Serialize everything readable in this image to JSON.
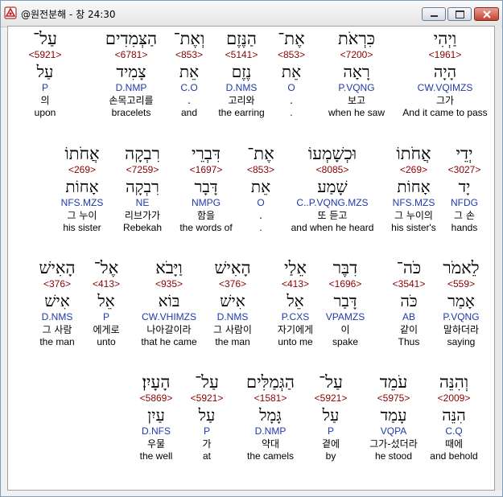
{
  "window": {
    "title": "@원전분해 - 창 24:30"
  },
  "rows": [
    [
      {
        "heb": "וַיְהִי",
        "strong": "<1961>",
        "lemma": "הָיָה",
        "morph": "CW.VQIMZS",
        "kor": "그가",
        "eng": "And it came to pass",
        "highlight": true
      },
      {
        "heb": "כִּרְאֹת",
        "strong": "<7200>",
        "lemma": "רָאָה",
        "morph": "P.VQNG",
        "kor": "보고",
        "eng": "when he saw"
      },
      {
        "heb": "אֶת־",
        "strong": "<853>",
        "lemma": "אֵת",
        "morph": "O",
        "kor": ".",
        "eng": "."
      },
      {
        "heb": "הַנֶּזֶם",
        "strong": "<5141>",
        "lemma": "נֶזֶם",
        "morph": "D.NMS",
        "kor": "고리와",
        "eng": "the earring"
      },
      {
        "heb": "וְאֶת־",
        "strong": "<853>",
        "lemma": "אֵת",
        "morph": "C.O",
        "kor": ".",
        "eng": "and"
      },
      {
        "heb": "הַצְּמִדִים",
        "strong": "<6781>",
        "lemma": "צָמִיד",
        "morph": "D.NMP",
        "kor": "손목고리를",
        "eng": "bracelets"
      },
      {
        "heb": "עַל־",
        "strong": "<5921>",
        "lemma": "עַל",
        "morph": "P",
        "kor": "의",
        "eng": "upon"
      }
    ],
    [
      {
        "heb": "יְדֵי",
        "strong": "<3027>",
        "lemma": "יָד",
        "morph": "NFDG",
        "kor": "그 손",
        "eng": "hands"
      },
      {
        "heb": "אֲחֹתוֹ",
        "strong": "<269>",
        "lemma": "אָחוֹת",
        "morph": "NFS.MZS",
        "kor": "그 누이의",
        "eng": "his sister's"
      },
      {
        "heb": "וּכְשָׁמְעוֹ",
        "strong": "<8085>",
        "lemma": "שָׁמַע",
        "morph": "C..P.VQNG.MZS",
        "kor": "또 듣고",
        "eng": "and when he heard"
      },
      {
        "heb": "אֶת־",
        "strong": "<853>",
        "lemma": "אֵת",
        "morph": "O",
        "kor": ".",
        "eng": "."
      },
      {
        "heb": "דִּבְרֵי",
        "strong": "<1697>",
        "lemma": "דָּבָר",
        "morph": "NMPG",
        "kor": "함을",
        "eng": "the words of"
      },
      {
        "heb": "רִבְקָה",
        "strong": "<7259>",
        "lemma": "רִבְקָה",
        "morph": "NE",
        "kor": "리브가가",
        "eng": "Rebekah"
      },
      {
        "heb": "אֲחֹתוֹ",
        "strong": "<269>",
        "lemma": "אָחוֹת",
        "morph": "NFS.MZS",
        "kor": "그 누이",
        "eng": "his sister"
      }
    ],
    [
      {
        "heb": "לֵאמֹר",
        "strong": "<559>",
        "lemma": "אָמַר",
        "morph": "P.VQNG",
        "kor": "말하더라",
        "eng": "saying"
      },
      {
        "heb": "כֹּה־",
        "strong": "<3541>",
        "lemma": "כֹּה",
        "morph": "AB",
        "kor": "같이",
        "eng": "Thus"
      },
      {
        "heb": "דִבֶּר",
        "strong": "<1696>",
        "lemma": "דָּבַר",
        "morph": "VPAMZS",
        "kor": "이",
        "eng": "spake"
      },
      {
        "heb": "אֵלַי",
        "strong": "<413>",
        "lemma": "אֵל",
        "morph": "P.CXS",
        "kor": "자기에게",
        "eng": "unto me"
      },
      {
        "heb": "הָאִישׁ",
        "strong": "<376>",
        "lemma": "אִישׁ",
        "morph": "D.NMS",
        "kor": "그 사람이",
        "eng": "the man"
      },
      {
        "heb": "וַיָּבֹא",
        "strong": "<935>",
        "lemma": "בּוֹא",
        "morph": "CW.VHIMZS",
        "kor": "나아갈이라",
        "eng": "that he came"
      },
      {
        "heb": "אֶל־",
        "strong": "<413>",
        "lemma": "אֵל",
        "morph": "P",
        "kor": "에게로",
        "eng": "unto"
      },
      {
        "heb": "הָאִישׁ",
        "strong": "<376>",
        "lemma": "אִישׁ",
        "morph": "D.NMS",
        "kor": "그 사람",
        "eng": "the man"
      }
    ],
    [
      {
        "heb": "וְהִנֵּה",
        "strong": "<2009>",
        "lemma": "הִנֵּה",
        "morph": "C.Q",
        "kor": "때에",
        "eng": "and behold"
      },
      {
        "heb": "עֹמֵד",
        "strong": "<5975>",
        "lemma": "עָמַד",
        "morph": "VQPA",
        "kor": "그가-섰더라",
        "eng": "he stood"
      },
      {
        "heb": "עַל־",
        "strong": "<5921>",
        "lemma": "עַל",
        "morph": "P",
        "kor": "곁에",
        "eng": "by"
      },
      {
        "heb": "הַגְּמַלִּים",
        "strong": "<1581>",
        "lemma": "גָּמָל",
        "morph": "D.NMP",
        "kor": "약대",
        "eng": "the camels"
      },
      {
        "heb": "עַל־",
        "strong": "<5921>",
        "lemma": "עַל",
        "morph": "P",
        "kor": "가",
        "eng": "at"
      },
      {
        "heb": "הָעָיִן׃",
        "strong": "<5869>",
        "lemma": "עַיִן",
        "morph": "D.NFS",
        "kor": "우물",
        "eng": "the well"
      }
    ]
  ]
}
